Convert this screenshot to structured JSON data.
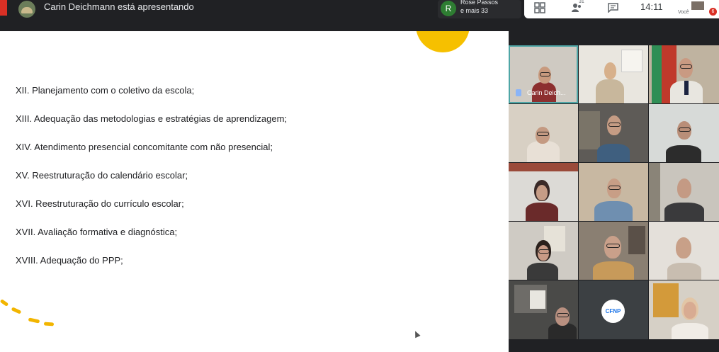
{
  "topbar": {
    "presenting": "Carin Deichmann está apresentando",
    "participants_chip": {
      "avatar_initial": "R",
      "name": "Rose Passos",
      "more": "e mais 33"
    },
    "people_count": "31",
    "clock": "14:11",
    "self_label": "Você",
    "notification_count": "6",
    "icons": [
      "layout-icon",
      "people-icon",
      "chat-icon",
      "activities-icon"
    ]
  },
  "slide": {
    "items": [
      "XII. Planejamento com o coletivo da escola;",
      "XIII. Adequação das metodologias e estratégias de aprendizagem;",
      "XIV. Atendimento presencial concomitante com não presencial;",
      "XV. Reestruturação do calendário escolar;",
      "XVI. Reestruturação do currículo escolar;",
      "XVII. Avaliação formativa e diagnóstica;",
      "XVIII. Adequação do PPP;"
    ],
    "accent_color": "#f6c000"
  },
  "grid": {
    "speaker_name": "Carin Deich...",
    "org_logo": "CFNP"
  }
}
